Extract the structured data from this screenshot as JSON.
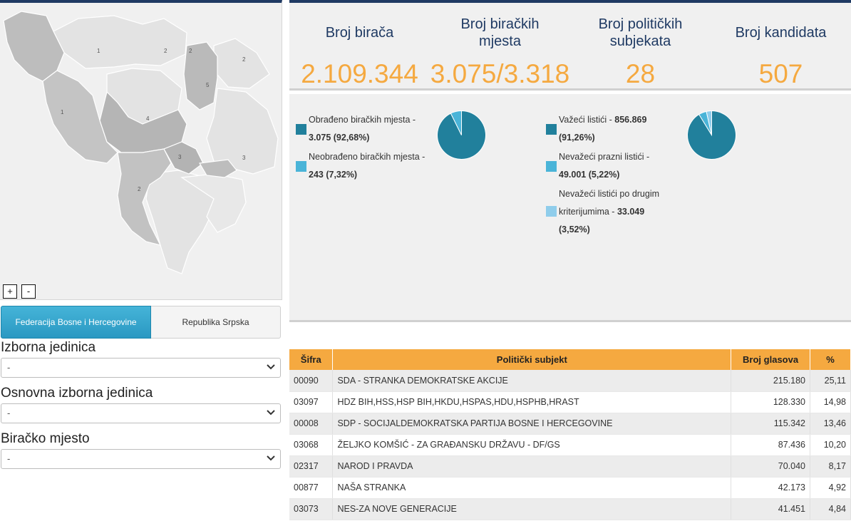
{
  "map": {
    "region_labels": [
      "1",
      "2",
      "2",
      "2",
      "5",
      "1",
      "4",
      "3",
      "3",
      "2"
    ],
    "zoom_in": "+",
    "zoom_out": "-"
  },
  "entity_tabs": {
    "active": "Federacija Bosne i Hercegovine",
    "inactive": "Republika Srpska"
  },
  "filters": [
    {
      "label": "Izborna jedinica",
      "value": "-"
    },
    {
      "label": "Osnovna izborna jedinica",
      "value": "-"
    },
    {
      "label": "Biračko mjesto",
      "value": "-"
    }
  ],
  "stats": [
    {
      "label_line1": "Broj birača",
      "label_line2": "",
      "value": "2.109.344"
    },
    {
      "label_line1": "Broj biračkih",
      "label_line2": "mjesta",
      "value": "3.075/3.318"
    },
    {
      "label_line1": "Broj političkih",
      "label_line2": "subjekata",
      "value": "28"
    },
    {
      "label_line1": "Broj kandidata",
      "label_line2": "",
      "value": "507"
    }
  ],
  "polling_stations": {
    "legend": [
      {
        "text_a": "Obrađeno biračkih mjesta -",
        "text_b": "3.075 (92,68%)",
        "color": "#21809c",
        "share": 92.68
      },
      {
        "text_a": "Neobrađeno biračkih mjesta -",
        "text_b": "243 (7,32%)",
        "color": "#4ab4d8",
        "share": 7.32
      }
    ]
  },
  "ballots": {
    "legend": [
      {
        "text_a": "Važeći listići - ",
        "text_a_bold": "856.869",
        "text_b": "(91,26%)",
        "color": "#21809c",
        "share": 91.26
      },
      {
        "text_a": "Nevažeći prazni listići -",
        "text_a_bold": "",
        "text_b": "49.001 (5,22%)",
        "color": "#4ab4d8",
        "share": 5.22
      },
      {
        "text_a": "Nevažeći listići po drugim",
        "text_a_bold": "",
        "text_b_plain": "kriterijumima - ",
        "text_b": "33.049",
        "text_c": "(3,52%)",
        "color": "#8fcdeb",
        "share": 3.52
      }
    ]
  },
  "table": {
    "headers": [
      "Šifra",
      "Politički subjekt",
      "Broj glasova",
      "%"
    ],
    "rows": [
      [
        "00090",
        "SDA - STRANKA DEMOKRATSKE AKCIJE",
        "215.180",
        "25,11"
      ],
      [
        "03097",
        "HDZ BIH,HSS,HSP BIH,HKDU,HSPAS,HDU,HSPHB,HRAST",
        "128.330",
        "14,98"
      ],
      [
        "00008",
        "SDP - SOCIJALDEMOKRATSKA PARTIJA BOSNE I HERCEGOVINE",
        "115.342",
        "13,46"
      ],
      [
        "03068",
        "ŽELJKO KOMŠIĆ - ZA GRAĐANSKU DRŽAVU - DF/GS",
        "87.436",
        "10,20"
      ],
      [
        "02317",
        "NAROD I PRAVDA",
        "70.040",
        "8,17"
      ],
      [
        "00877",
        "NAŠA STRANKA",
        "42.173",
        "4,92"
      ],
      [
        "03073",
        "NES-ZA NOVE GENERACIJE",
        "41.451",
        "4,84"
      ]
    ]
  }
}
